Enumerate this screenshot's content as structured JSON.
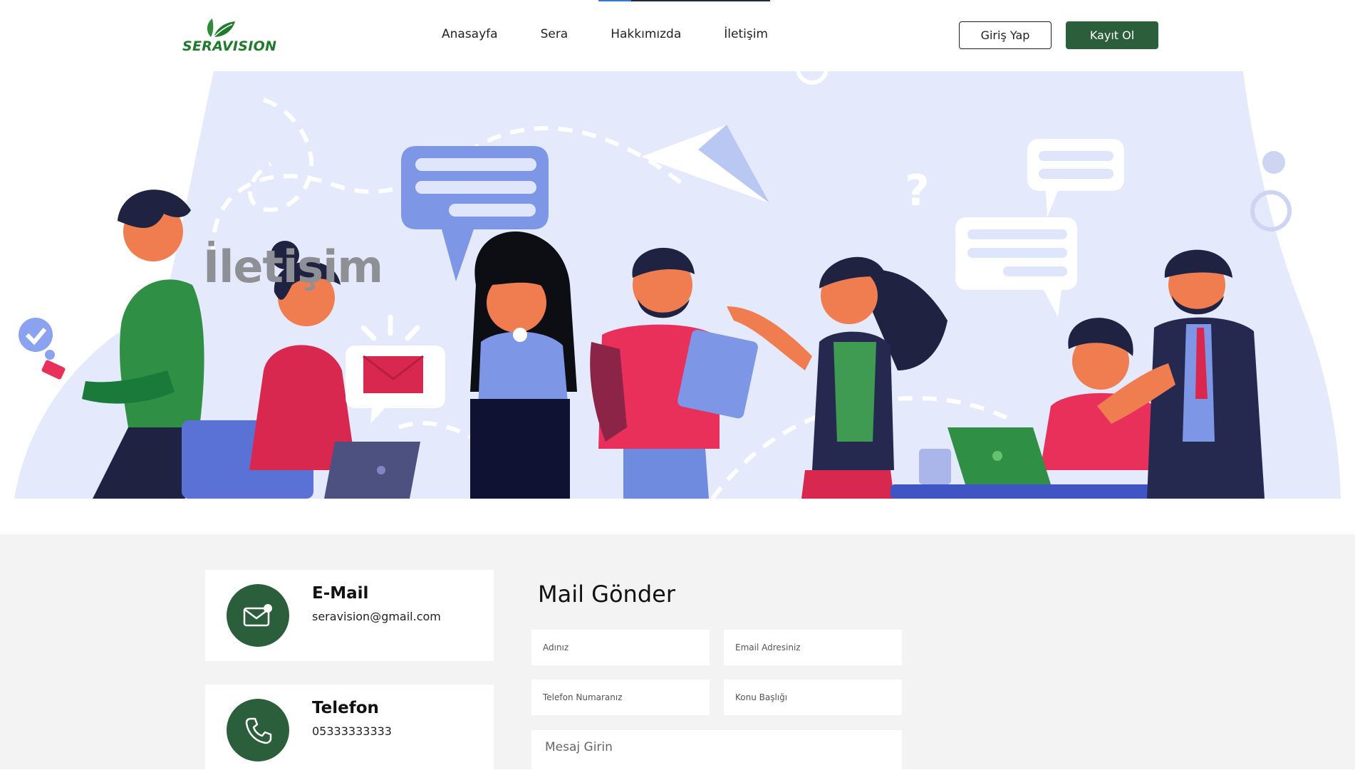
{
  "brand": {
    "name": "SERAVISION",
    "color": "#1f7a2c"
  },
  "nav": {
    "items": [
      {
        "label": "Anasayfa"
      },
      {
        "label": "Sera"
      },
      {
        "label": "Hakkımızda"
      },
      {
        "label": "İletişim"
      }
    ]
  },
  "auth": {
    "login_label": "Giriş Yap",
    "register_label": "Kayıt Ol"
  },
  "hero": {
    "title": "İletişim",
    "illustration": "team-communication-illustration"
  },
  "contact": {
    "email": {
      "title": "E-Mail",
      "value": "seravision@gmail.com",
      "icon": "mail-icon"
    },
    "phone": {
      "title": "Telefon",
      "value": "05333333333",
      "icon": "phone-icon"
    }
  },
  "form": {
    "title": "Mail Gönder",
    "name_placeholder": "Adınız",
    "email_placeholder": "Email Adresiniz",
    "phone_placeholder": "Telefon Numaranız",
    "subject_placeholder": "Konu Başlığı",
    "message_placeholder": "Mesaj Girin"
  },
  "colors": {
    "accent": "#2b5e3a",
    "hero_bg": "#e4e9fb",
    "section_bg": "#f3f3f3"
  }
}
